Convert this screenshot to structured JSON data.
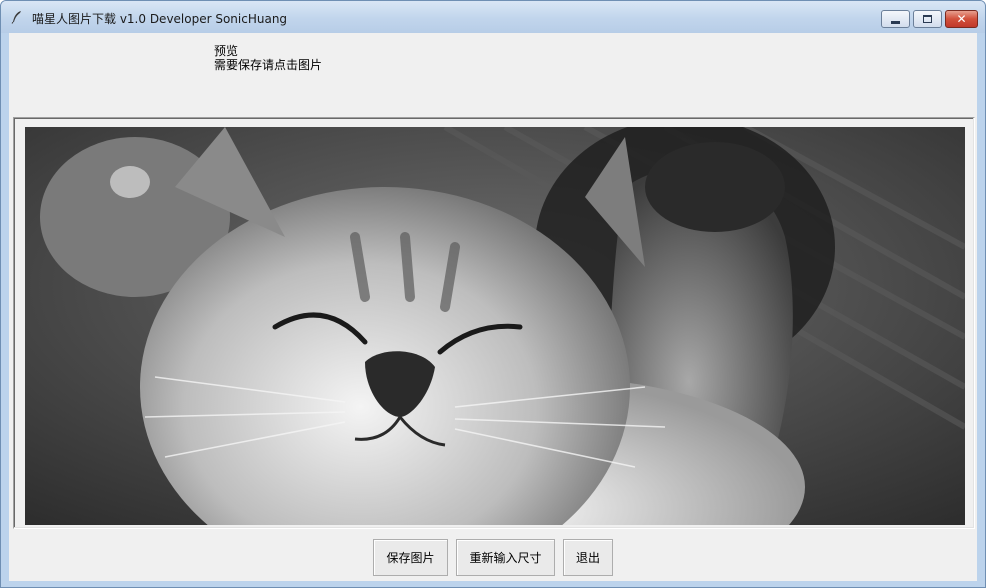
{
  "window": {
    "title": "喵星人图片下载 v1.0 Developer SonicHuang",
    "icon": "feather-icon",
    "controls": {
      "minimize": "minimize-icon",
      "maximize": "maximize-icon",
      "close": "close-icon",
      "close_glyph": "✕"
    }
  },
  "header": {
    "preview_label": "预览",
    "save_hint": "需要保存请点击图片"
  },
  "image": {
    "subject": "cat-photo",
    "style": "grayscale"
  },
  "buttons": {
    "save_label": "保存图片",
    "resize_label": "重新输入尺寸",
    "exit_label": "退出"
  },
  "colors": {
    "title_bar": "#c1d5ec",
    "client_bg": "#f0f0f0",
    "close_button": "#c0392b"
  }
}
